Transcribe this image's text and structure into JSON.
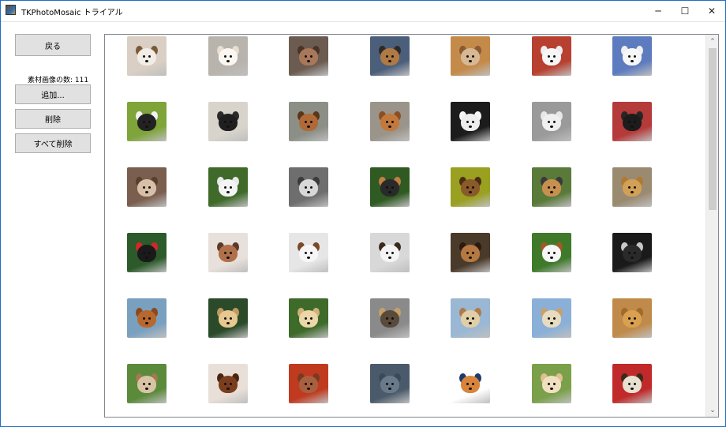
{
  "window": {
    "title": "TKPhotoMosaic トライアル",
    "minimize_glyph": "─",
    "maximize_glyph": "☐",
    "close_glyph": "✕"
  },
  "left_panel": {
    "back_label": "戻る",
    "count_label": "素材画像の数: 111",
    "add_label": "追加...",
    "delete_label": "削除",
    "delete_all_label": "すべて削除"
  },
  "gallery": {
    "scroll_up_glyph": "⌃",
    "scroll_down_glyph": "⌄",
    "rows": [
      [
        {
          "bg": "#d9cfc4",
          "dog": "#f2ede6",
          "ear": "#7a5a3a"
        },
        {
          "bg": "#b8b3ac",
          "dog": "#faf7f2",
          "ear": "#e7ddd0"
        },
        {
          "bg": "#6b5b50",
          "dog": "#a8785a",
          "ear": "#4a3426"
        },
        {
          "bg": "#4b5f7a",
          "dog": "#b07a45",
          "ear": "#2e2a26"
        },
        {
          "bg": "#c48a4a",
          "dog": "#d6b894",
          "ear": "#8a5a30"
        },
        {
          "bg": "#b84030",
          "dog": "#f6f6f6",
          "ear": "#eeeeee"
        },
        {
          "bg": "#5d7bbf",
          "dog": "#f7f7f7",
          "ear": "#efefef"
        }
      ],
      [
        {
          "bg": "#7ea43a",
          "dog": "#222222",
          "ear": "#f2f2f2"
        },
        {
          "bg": "#d8d4cc",
          "dog": "#1f1f1f",
          "ear": "#2a2a2a"
        },
        {
          "bg": "#8b8f86",
          "dog": "#b06a38",
          "ear": "#5a3618"
        },
        {
          "bg": "#9a948a",
          "dog": "#c2793c",
          "ear": "#8a4f24"
        },
        {
          "bg": "#1c1c1c",
          "dog": "#ededed",
          "ear": "#f5f5f5"
        },
        {
          "bg": "#9a9a9a",
          "dog": "#f0f0f0",
          "ear": "#e8e8e8"
        },
        {
          "bg": "#b53a3a",
          "dog": "#1c1c1c",
          "ear": "#262626"
        }
      ],
      [
        {
          "bg": "#7a5e4e",
          "dog": "#d8c0a8",
          "ear": "#5a3e2e"
        },
        {
          "bg": "#3f6a2a",
          "dog": "#f4f4f4",
          "ear": "#e8e8e8"
        },
        {
          "bg": "#6e6e6e",
          "dog": "#d8d8d8",
          "ear": "#3a3a3a"
        },
        {
          "bg": "#2f5a22",
          "dog": "#2a2a2a",
          "ear": "#c08040"
        },
        {
          "bg": "#9aa020",
          "dog": "#8a5a2a",
          "ear": "#4a2e14"
        },
        {
          "bg": "#5a7a3a",
          "dog": "#c89050",
          "ear": "#3a3a3a"
        },
        {
          "bg": "#9a8a70",
          "dog": "#d2a056",
          "ear": "#b07a30"
        }
      ],
      [
        {
          "bg": "#2c5a2a",
          "dog": "#1a1a1a",
          "ear": "#cc2a2a"
        },
        {
          "bg": "#e8e0da",
          "dog": "#b0704a",
          "ear": "#5a3a2a"
        },
        {
          "bg": "#e6e6e6",
          "dog": "#f6f6f6",
          "ear": "#7a4a28"
        },
        {
          "bg": "#d8d8d8",
          "dog": "#f4f4f4",
          "ear": "#3a2a1a"
        },
        {
          "bg": "#4a3a2a",
          "dog": "#b57840",
          "ear": "#2a1a10"
        },
        {
          "bg": "#3e7a2a",
          "dog": "#f6f6f6",
          "ear": "#a05a2a"
        },
        {
          "bg": "#1a1a1a",
          "dog": "#2a2a2a",
          "ear": "#c8c8c8"
        }
      ],
      [
        {
          "bg": "#7aa0c0",
          "dog": "#b8682e",
          "ear": "#8a4a20"
        },
        {
          "bg": "#2a4a2a",
          "dog": "#e6c890",
          "ear": "#c09a60"
        },
        {
          "bg": "#3e6a2a",
          "dog": "#ecd7a8",
          "ear": "#d2b07a"
        },
        {
          "bg": "#8a8a8a",
          "dog": "#5a4a3a",
          "ear": "#c4a06a"
        },
        {
          "bg": "#9ab8d4",
          "dog": "#e0cfa6",
          "ear": "#b07a4a"
        },
        {
          "bg": "#8ab0d8",
          "dog": "#e8dcc0",
          "ear": "#c8a070"
        },
        {
          "bg": "#c08a4a",
          "dog": "#d8a050",
          "ear": "#a06a2a"
        }
      ],
      [
        {
          "bg": "#5a8a3a",
          "dog": "#d8c4a4",
          "ear": "#a07a50"
        },
        {
          "bg": "#e8e0d8",
          "dog": "#7a3e1e",
          "ear": "#4a2410"
        },
        {
          "bg": "#c03a20",
          "dog": "#a86040",
          "ear": "#7a3a20"
        },
        {
          "bg": "#4a5a6a",
          "dog": "#6a7a8a",
          "ear": "#3a4a5a"
        },
        {
          "bg": "#ffffff",
          "dog": "#d8843a",
          "ear": "#1e3a6a"
        },
        {
          "bg": "#7aa04a",
          "dog": "#f0e0c0",
          "ear": "#e0c090"
        },
        {
          "bg": "#c02a2a",
          "dog": "#e8e0d0",
          "ear": "#3a2a1a"
        }
      ]
    ]
  }
}
